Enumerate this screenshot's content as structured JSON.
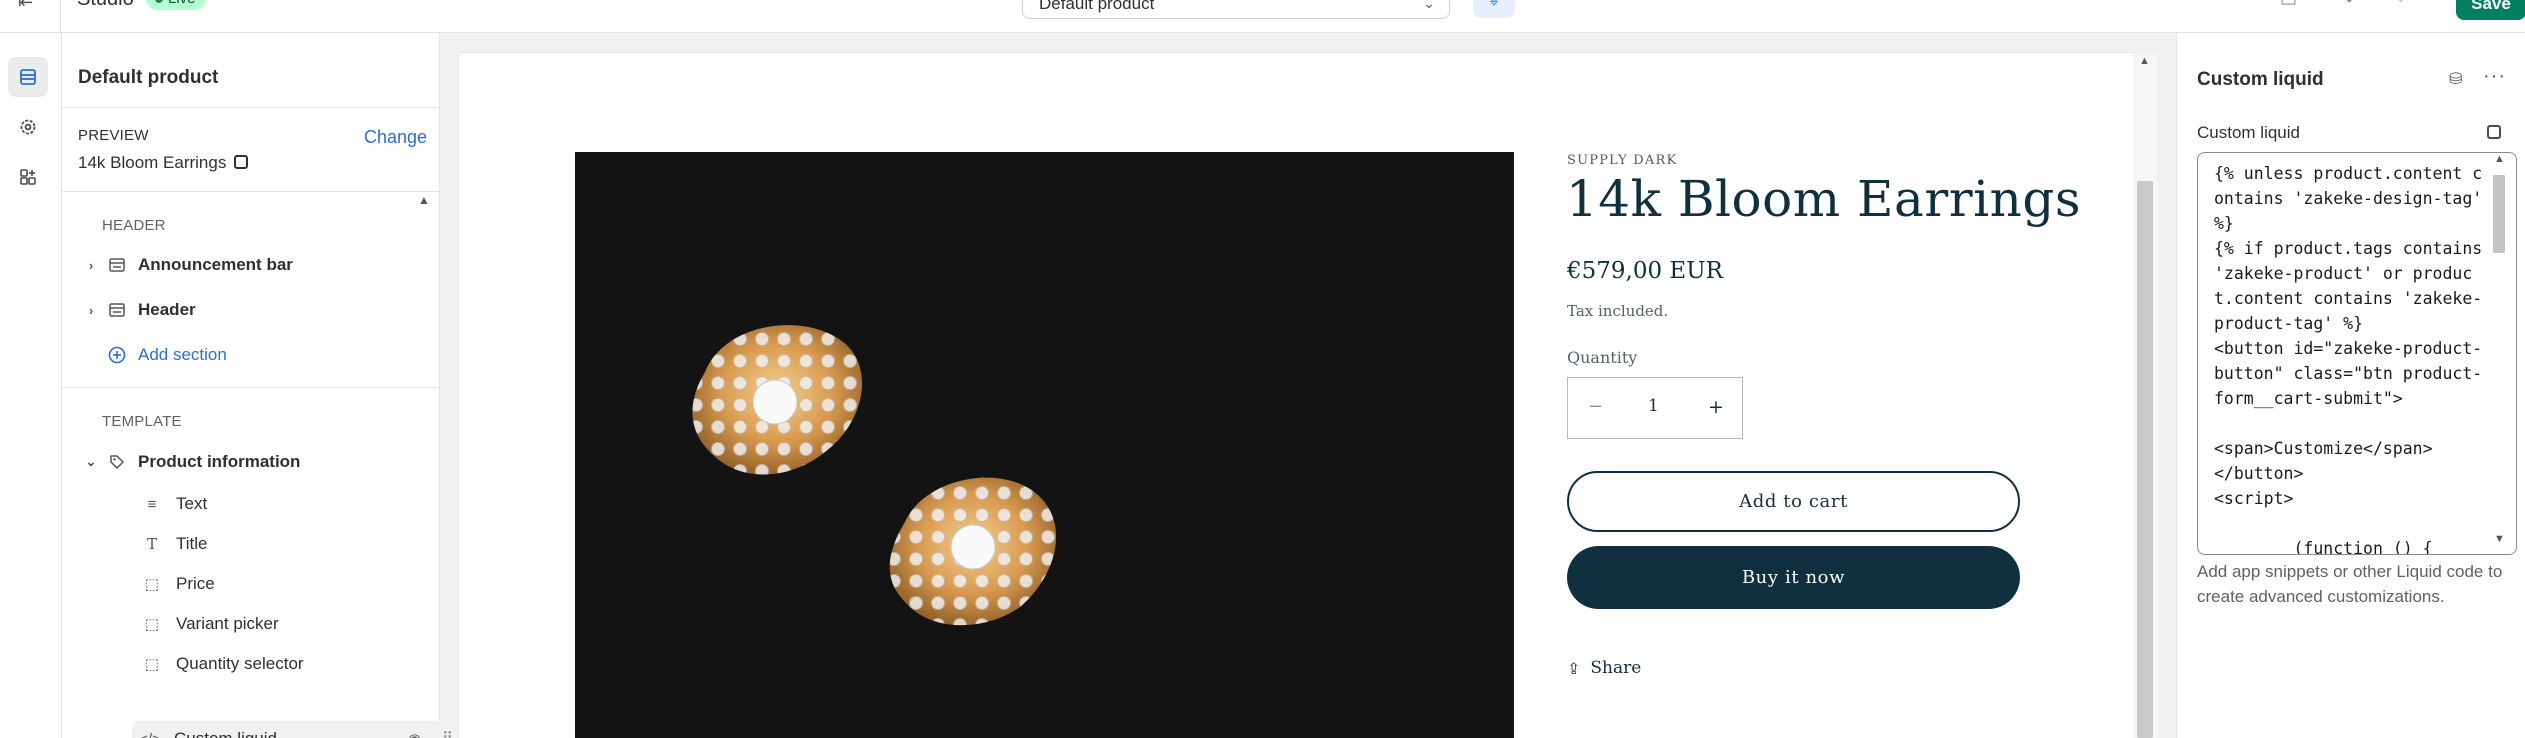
{
  "topbar": {
    "theme_name": "Studio",
    "status_badge": "Live",
    "template_select": "Default product",
    "save_label": "Save"
  },
  "sidebar": {
    "title": "Default product",
    "preview_label": "PREVIEW",
    "preview_value": "14k Bloom Earrings",
    "change_label": "Change",
    "header_group": "HEADER",
    "header_items": [
      "Announcement bar",
      "Header"
    ],
    "add_section": "Add section",
    "template_group": "TEMPLATE",
    "product_section": "Product information",
    "blocks": [
      "Text",
      "Title",
      "Price",
      "Variant picker",
      "Quantity selector",
      "Custom liquid"
    ]
  },
  "product": {
    "vendor": "SUPPLY DARK",
    "title": "14k Bloom Earrings",
    "price": "€579,00 EUR",
    "tax_note": "Tax included.",
    "quantity_label": "Quantity",
    "quantity_value": "1",
    "minus": "−",
    "plus": "+",
    "add_to_cart": "Add to cart",
    "buy_now": "Buy it now",
    "share": "Share"
  },
  "right_panel": {
    "title": "Custom liquid",
    "field_label": "Custom liquid",
    "code": "{% unless product.content contains 'zakeke-design-tag' %}\n{% if product.tags contains 'zakeke-product' or product.content contains 'zakeke-product-tag' %}\n<button id=\"zakeke-product-button\" class=\"btn product-form__cart-submit\">\n\n<span>Customize</span>\n</button>\n<script>\n\n        (function () {",
    "help_text": "Add app snippets or other Liquid code to create advanced customizations."
  },
  "colors": {
    "brand_dark": "#11303f",
    "link_blue": "#2c6ecb",
    "save_green": "#008060",
    "live_badge_bg": "#b4fed2"
  },
  "icons": [
    "exit-icon",
    "sections-icon",
    "settings-gear-icon",
    "app-blocks-icon",
    "inspector-icon",
    "monitor-icon",
    "undo-icon",
    "redo-icon",
    "external-link-icon",
    "database-icon",
    "more-icon",
    "share-icon",
    "eye-icon",
    "drag-handle-icon"
  ]
}
